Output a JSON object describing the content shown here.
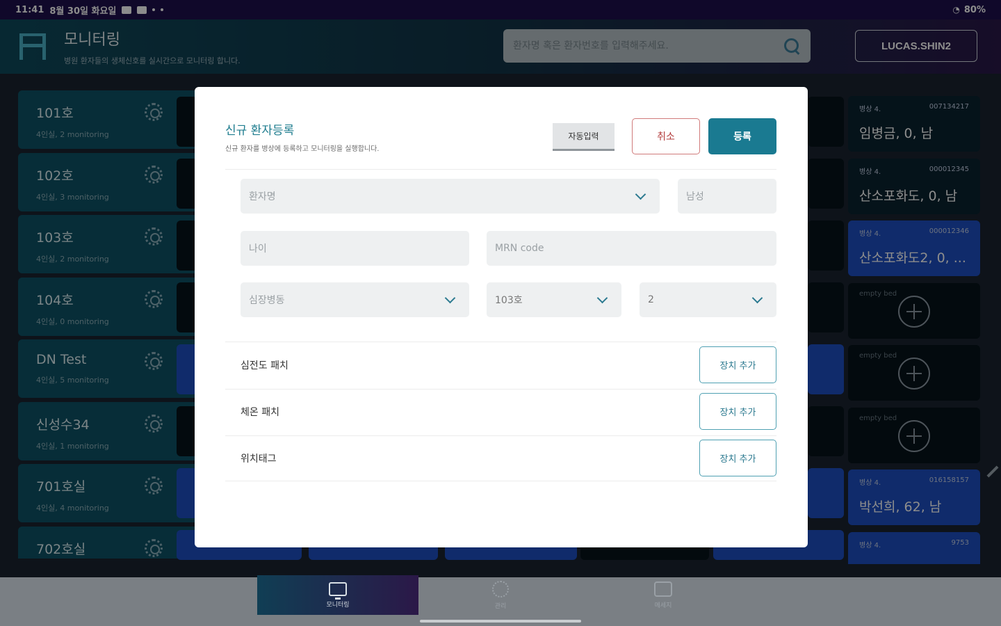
{
  "statusbar": {
    "time": "11:41",
    "date": "8월 30일 화요일",
    "battery": "80%"
  },
  "header": {
    "title": "모니터링",
    "subtitle": "병원 환자들의 생체신호를 실시간으로 모니터링 합니다.",
    "search_placeholder": "환자명 혹은 환자번호를 입력해주세요.",
    "user": "LUCAS.SHIN2"
  },
  "rooms": [
    {
      "name": "101호",
      "info": "4인실, 2 monitoring"
    },
    {
      "name": "102호",
      "info": "4인실, 3 monitoring"
    },
    {
      "name": "103호",
      "info": "4인실, 2 monitoring"
    },
    {
      "name": "104호",
      "info": "4인실, 0 monitoring"
    },
    {
      "name": "DN Test",
      "info": "4인실, 5 monitoring"
    },
    {
      "name": "신성수34",
      "info": "4인실, 1 monitoring"
    },
    {
      "name": "701호실",
      "info": "4인실, 4 monitoring"
    },
    {
      "name": "702호실",
      "info": ""
    }
  ],
  "beds": [
    {
      "bed": "병상 4.",
      "id": "007134217",
      "name": "임병금, 0, 남"
    },
    {
      "bed": "병상 4.",
      "id": "000012345",
      "name": "산소포화도, 0, 남"
    },
    {
      "bed": "병상 4.",
      "id": "000012346",
      "name": "산소포화도2, 0, ..."
    },
    {
      "empty_label": "empty bed"
    },
    {
      "empty_label": "empty bed"
    },
    {
      "empty_label": "empty bed"
    },
    {
      "bed": "병상 4.",
      "id": "016158157",
      "name": "박선희, 62, 남"
    },
    {
      "bed": "병상 4.",
      "id": "9753",
      "name": ""
    }
  ],
  "modal": {
    "title": "신규 환자등록",
    "description": "신규 환자를 병상에 등록하고 모니터링을 실행합니다.",
    "auto_input": "자동입력",
    "cancel": "취소",
    "register": "등록",
    "fields": {
      "patient_name": "환자명",
      "gender": "남성",
      "age": "나이",
      "mrn": "MRN code",
      "ward": "심장병동",
      "room": "103호",
      "bed": "2"
    },
    "devices": [
      {
        "label": "심전도 패치",
        "button": "장치 추가"
      },
      {
        "label": "체온 패치",
        "button": "장치 추가"
      },
      {
        "label": "위치태그",
        "button": "장치 추가"
      }
    ]
  },
  "bottom_nav": [
    {
      "label": "모니터링"
    },
    {
      "label": "관리"
    },
    {
      "label": "메세지"
    }
  ],
  "colors": {
    "accent": "#1a7a91",
    "cancel": "#b23a3a",
    "bed_active": "#1e4fc4",
    "room_bg": "#0d5367"
  }
}
